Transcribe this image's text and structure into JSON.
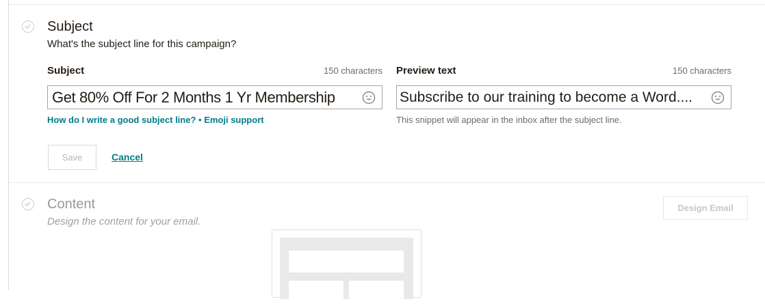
{
  "subject_section": {
    "title": "Subject",
    "description": "What's the subject line for this campaign?",
    "subject_field": {
      "label": "Subject",
      "char_count": "150 characters",
      "value": "Get 80% Off For 2 Months 1 Yr Membership"
    },
    "preview_field": {
      "label": "Preview text",
      "char_count": "150 characters",
      "value": "Subscribe to our training to become a Word...."
    },
    "help_link": "How do I write a good subject line?",
    "help_separator": " • ",
    "emoji_link": "Emoji support",
    "preview_note": "This snippet will appear in the inbox after the subject line.",
    "save_label": "Save",
    "cancel_label": "Cancel"
  },
  "content_section": {
    "title": "Content",
    "description": "Design the content for your email.",
    "design_button": "Design Email"
  },
  "colors": {
    "link": "#007c89",
    "text": "#241c15",
    "muted": "#a8a8a8"
  },
  "icons": [
    "check-circle-icon",
    "emoji-icon"
  ]
}
